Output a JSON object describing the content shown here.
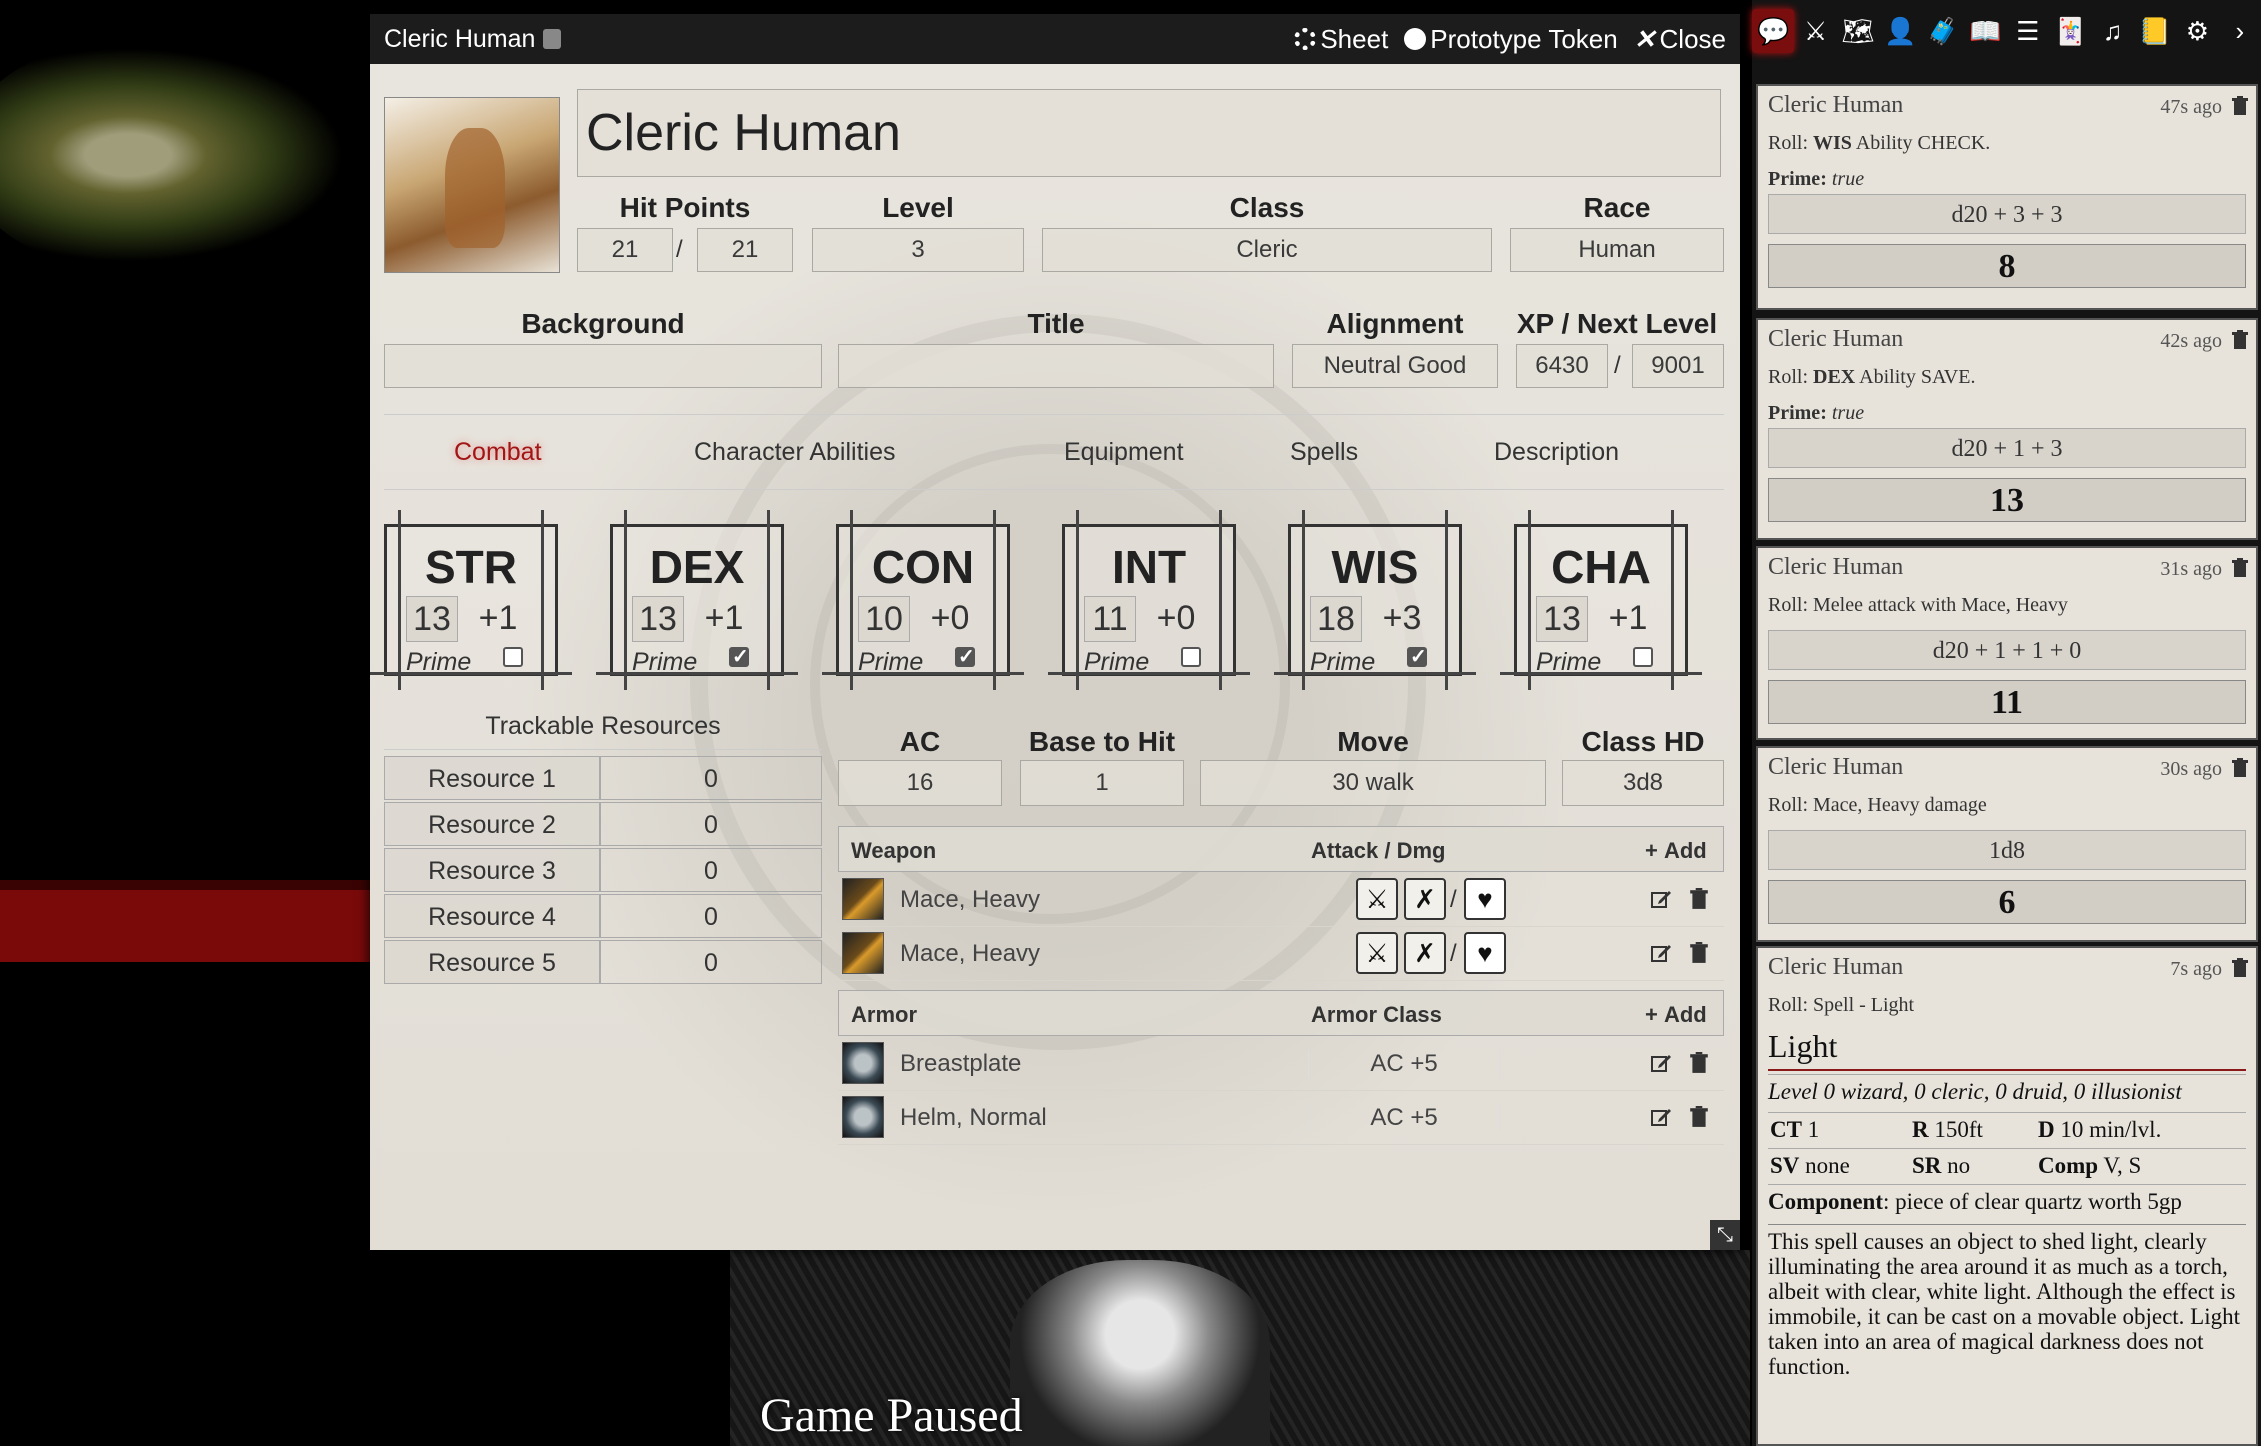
{
  "window": {
    "title": "Cleric Human",
    "sheet_label": "Sheet",
    "token_label": "Prototype Token",
    "close_label": "Close"
  },
  "character": {
    "name": "Cleric Human",
    "hp_label": "Hit Points",
    "hp_current": "21",
    "hp_max": "21",
    "level_label": "Level",
    "level": "3",
    "class_label": "Class",
    "class": "Cleric",
    "race_label": "Race",
    "race": "Human",
    "background_label": "Background",
    "background": "",
    "title_label": "Title",
    "title": "",
    "alignment_label": "Alignment",
    "alignment": "Neutral Good",
    "xp_label": "XP / Next Level",
    "xp": "6430",
    "next_level": "9001"
  },
  "tabs": [
    "Combat",
    "Character Abilities",
    "Equipment",
    "Spells",
    "Description"
  ],
  "abilities": [
    {
      "name": "STR",
      "score": "13",
      "mod": "+1",
      "prime": false
    },
    {
      "name": "DEX",
      "score": "13",
      "mod": "+1",
      "prime": true
    },
    {
      "name": "CON",
      "score": "10",
      "mod": "+0",
      "prime": true
    },
    {
      "name": "INT",
      "score": "11",
      "mod": "+0",
      "prime": false
    },
    {
      "name": "WIS",
      "score": "18",
      "mod": "+3",
      "prime": true
    },
    {
      "name": "CHA",
      "score": "13",
      "mod": "+1",
      "prime": false
    }
  ],
  "prime_label": "Prime",
  "resources": {
    "title": "Trackable Resources",
    "items": [
      {
        "name": "Resource 1",
        "value": "0"
      },
      {
        "name": "Resource 2",
        "value": "0"
      },
      {
        "name": "Resource 3",
        "value": "0"
      },
      {
        "name": "Resource 4",
        "value": "0"
      },
      {
        "name": "Resource 5",
        "value": "0"
      }
    ]
  },
  "combat": {
    "ac_label": "AC",
    "ac": "16",
    "bth_label": "Base to Hit",
    "bth": "1",
    "move_label": "Move",
    "move": "30 walk",
    "hd_label": "Class HD",
    "hd": "3d8"
  },
  "weapons": {
    "col_weapon": "Weapon",
    "col_attack": "Attack / Dmg",
    "add_label": "Add",
    "items": [
      {
        "name": "Mace, Heavy"
      },
      {
        "name": "Mace, Heavy"
      }
    ]
  },
  "armor": {
    "col_armor": "Armor",
    "col_ac": "Armor Class",
    "add_label": "Add",
    "items": [
      {
        "name": "Breastplate",
        "ac": "AC +5"
      },
      {
        "name": "Helm, Normal",
        "ac": "AC +5"
      }
    ]
  },
  "game_paused": "Game Paused",
  "chat": [
    {
      "speaker": "Cleric Human",
      "time": "47s ago",
      "flavor_pre": "Roll: ",
      "flavor_b": "WIS",
      "flavor_post": " Ability CHECK.",
      "prime_label": "Prime:",
      "prime_val": "true",
      "formula": "d20 + 3 + 3",
      "total": "8"
    },
    {
      "speaker": "Cleric Human",
      "time": "42s ago",
      "flavor_pre": "Roll: ",
      "flavor_b": "DEX",
      "flavor_post": " Ability SAVE.",
      "prime_label": "Prime:",
      "prime_val": "true",
      "formula": "d20 + 1 + 3",
      "total": "13"
    },
    {
      "speaker": "Cleric Human",
      "time": "31s ago",
      "flavor": "Roll: Melee attack with Mace, Heavy",
      "formula": "d20 + 1 + 1 + 0",
      "total": "11"
    },
    {
      "speaker": "Cleric Human",
      "time": "30s ago",
      "flavor": "Roll: Mace, Heavy damage",
      "formula": "1d8",
      "total": "6"
    }
  ],
  "spell_card": {
    "speaker": "Cleric Human",
    "time": "7s ago",
    "flavor": "Roll: Spell - Light",
    "name": "Light",
    "levels": "Level 0 wizard, 0 cleric, 0 druid, 0 illusionist",
    "ct_label": "CT",
    "ct": "1",
    "r_label": "R",
    "r": "150ft",
    "d_label": "D",
    "d": "10 min/lvl.",
    "sv_label": "SV",
    "sv": "none",
    "sr_label": "SR",
    "sr": "no",
    "comp_label": "Comp",
    "comp": "V, S",
    "component_label": "Component",
    "component": ": piece of clear quartz worth 5gp",
    "description": "This spell causes an object to shed light, clearly illuminating the area around it as much as a torch, albeit with clear, white light. Although the effect is immobile, it can be cast on a movable object. Light taken into an area of magical darkness does not function."
  },
  "colors": {
    "accent_red": "#a31515",
    "tab_active": "#7a0d0d"
  },
  "sidebar_icons": [
    "chat-icon",
    "combat-icon",
    "scenes-icon",
    "actors-icon",
    "items-icon",
    "journal-icon",
    "tables-icon",
    "cards-icon",
    "playlists-icon",
    "compendium-icon",
    "settings-icon",
    "collapse-icon"
  ]
}
